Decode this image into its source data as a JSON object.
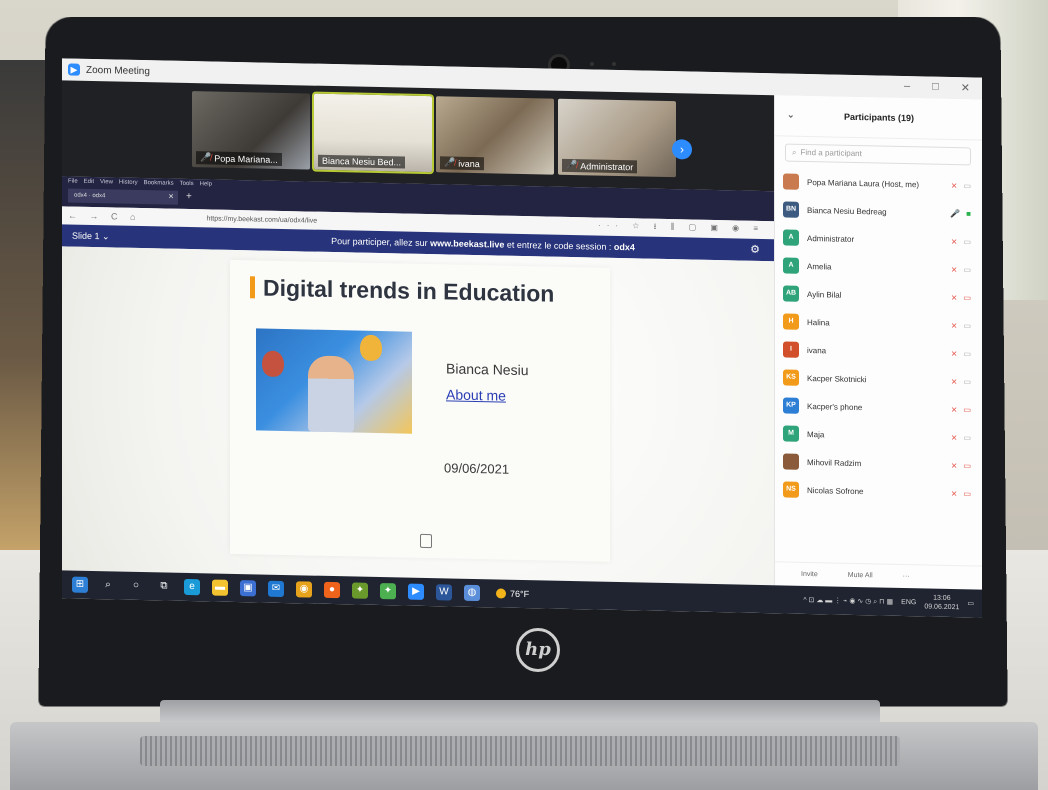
{
  "zoom": {
    "window_title": "Zoom Meeting",
    "window_controls": [
      "–",
      "□",
      "✕"
    ]
  },
  "gallery": {
    "tiles": [
      {
        "name": "Popa Mariana...",
        "mic_muted": true
      },
      {
        "name": "Bianca Nesiu Bed...",
        "mic_muted": false
      },
      {
        "name": "ivana",
        "mic_muted": true
      },
      {
        "name": "Administrator",
        "mic_muted": true
      }
    ]
  },
  "browser": {
    "menu": [
      "File",
      "Edit",
      "View",
      "History",
      "Bookmarks",
      "Tools",
      "Help"
    ],
    "tab_label": "odx4 · odx4",
    "new_tab": "+",
    "nav_glyphs": "← → C ⌂",
    "url": "https://my.beekast.com/ua/odx4/live",
    "toolbar_glyphs": "··· ☆   ⭳ ⫼ ▢ ▣ ◉ ≡"
  },
  "beekast": {
    "slide_selector": "Slide 1 ⌄",
    "banner_prefix": "Pour participer, allez sur ",
    "banner_site": "www.beekast.live",
    "banner_middle": " et entrez le code session : ",
    "banner_code": "odx4",
    "settings_icon": "⚙"
  },
  "slide": {
    "title": "Digital trends in Education",
    "name": "Bianca Nesiu",
    "link": "About me",
    "date": "09/06/2021"
  },
  "participants": {
    "header": "Participants (19)",
    "collapse_glyph": "⌄",
    "search_placeholder": "Find a participant",
    "list": [
      {
        "initials": "",
        "name": "Popa Mariana Laura (Host, me)",
        "color": "#c97a4e",
        "mic": "off",
        "cam": "off"
      },
      {
        "initials": "BN",
        "name": "Bianca Nesiu Bedreag",
        "color": "#3d5a80",
        "mic": "on",
        "cam": "on"
      },
      {
        "initials": "A",
        "name": "Administrator",
        "color": "#2fa37a",
        "mic": "off",
        "cam": "off"
      },
      {
        "initials": "A",
        "name": "Amelia",
        "color": "#2fa37a",
        "mic": "off",
        "cam": "off"
      },
      {
        "initials": "AB",
        "name": "Aylin Bilal",
        "color": "#2fa37a",
        "mic": "off",
        "cam": "blocked"
      },
      {
        "initials": "H",
        "name": "Halina",
        "color": "#f29a1a",
        "mic": "off",
        "cam": "off"
      },
      {
        "initials": "I",
        "name": "ivana",
        "color": "#d14f2a",
        "mic": "off",
        "cam": "off"
      },
      {
        "initials": "KS",
        "name": "Kacper Skotnicki",
        "color": "#f29a1a",
        "mic": "off",
        "cam": "off"
      },
      {
        "initials": "KP",
        "name": "Kacper's phone",
        "color": "#2d7fd6",
        "mic": "off",
        "cam": "blocked"
      },
      {
        "initials": "M",
        "name": "Maja",
        "color": "#2fa37a",
        "mic": "off",
        "cam": "off"
      },
      {
        "initials": "",
        "name": "Mihovil Radzim",
        "color": "#8a5a3a",
        "mic": "off",
        "cam": "blocked"
      },
      {
        "initials": "NS",
        "name": "Nicolas Sofrone",
        "color": "#f29a1a",
        "mic": "off",
        "cam": "blocked"
      }
    ],
    "footer_buttons": [
      "Invite",
      "Mute All",
      "···"
    ]
  },
  "taskbar": {
    "weather": "76°F",
    "language": "ENG",
    "time": "13:06",
    "date": "09.06.2021",
    "tray_glyphs": "^ ⊡ ☁ ▬ ⋮ ⌁ ◉ ∿ ◷ ⌕ ⊓ ▦",
    "apps": [
      {
        "icon": "windows-icon",
        "glyph": "⊞",
        "color": "#2d7fd6"
      },
      {
        "icon": "search-icon",
        "glyph": "⌕",
        "color": "transparent"
      },
      {
        "icon": "cortana-icon",
        "glyph": "○",
        "color": "transparent"
      },
      {
        "icon": "task-view-icon",
        "glyph": "⧉",
        "color": "transparent"
      },
      {
        "icon": "edge-icon",
        "glyph": "e",
        "color": "#1a9bd8"
      },
      {
        "icon": "file-explorer-icon",
        "glyph": "▬",
        "color": "#f2c230"
      },
      {
        "icon": "store-icon",
        "glyph": "▣",
        "color": "#3b6fd1"
      },
      {
        "icon": "mail-icon",
        "glyph": "✉",
        "color": "#1f78d1"
      },
      {
        "icon": "chrome-icon",
        "glyph": "◉",
        "color": "#e8a31c"
      },
      {
        "icon": "firefox-icon",
        "glyph": "●",
        "color": "#f0631b"
      },
      {
        "icon": "app-icon",
        "glyph": "✦",
        "color": "#6b9a2c"
      },
      {
        "icon": "app-icon-2",
        "glyph": "✦",
        "color": "#4caf50"
      },
      {
        "icon": "zoom-icon",
        "glyph": "▶",
        "color": "#2d8cff"
      },
      {
        "icon": "word-icon",
        "glyph": "W",
        "color": "#2b579a"
      },
      {
        "icon": "globe-icon",
        "glyph": "◍",
        "color": "#5b8ed9"
      }
    ]
  },
  "brand": {
    "laptop_logo": "hp"
  },
  "colors": {
    "zoom_blue": "#2d8cff",
    "beekast_bar": "#27337a",
    "title_accent": "#f29a1a",
    "taskbar": "#1f2430"
  }
}
